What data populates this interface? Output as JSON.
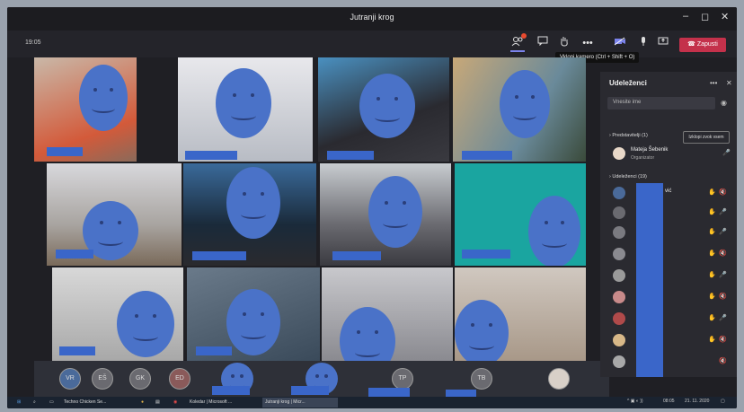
{
  "window": {
    "title": "Jutranji krog",
    "minimize": "–",
    "maximize": "◻",
    "close": "✕"
  },
  "toolbar": {
    "timer": "19:05",
    "leave_label": "Zapusti",
    "more": "•••",
    "tooltip": "Vklopi kamero (Ctrl + Shift + O)"
  },
  "panel": {
    "title": "Udeleženci",
    "more": "•••",
    "close": "✕",
    "search_placeholder": "Vnesite ime",
    "presenters_label": "Predstavitelji (1)",
    "mute_all_label": "Izklopi zvok vsem",
    "organizer_name": "Mateja Šebenik",
    "organizer_role": "Organizator",
    "attendees_label": "Udeleženci (19)",
    "partial_name": "vić"
  },
  "strip": {
    "initials": [
      "VR",
      "EŠ",
      "GK",
      "ED",
      "TP",
      "TB"
    ]
  },
  "taskbar": {
    "items": [
      "Techno Chicken Se...",
      "Koledar | Microsoft ...",
      "Jutranji krog | Micr..."
    ],
    "clock": "08:05",
    "date": "21. 11. 2020"
  },
  "colors": {
    "leave": "#c4314b",
    "accent": "#7b83eb",
    "redaction": "#3a66c9",
    "face": "#4a72c8"
  }
}
